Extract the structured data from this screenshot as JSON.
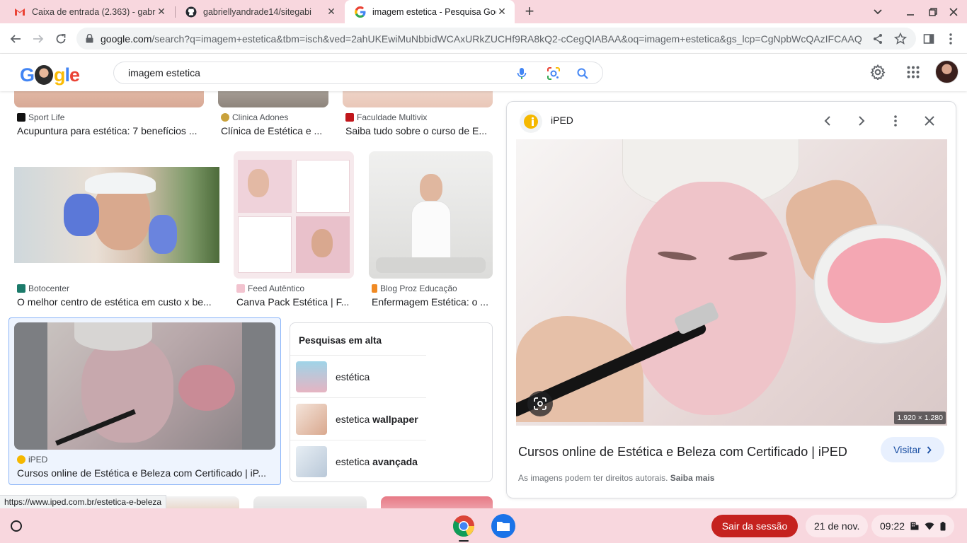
{
  "browser": {
    "tabs": [
      {
        "title": "Caixa de entrada (2.363) - gabri",
        "favicon": "gmail-icon",
        "active": false
      },
      {
        "title": "gabriellyandrade14/sitegabi",
        "favicon": "github-icon",
        "active": false
      },
      {
        "title": "imagem estetica - Pesquisa Goo",
        "favicon": "google-icon",
        "active": true
      }
    ],
    "url_host": "google.com",
    "url_rest": "/search?q=imagem+estetica&tbm=isch&ved=2ahUKEwiMuNbbidWCAxURkZUCHf9RA8kQ2-cCegQIABAA&oq=imagem+estetica&gs_lcp=CgNpbWcQAzIFCAAQg...",
    "colors": {
      "tabstrip": "#f8d7de",
      "shelf": "#f8d7de"
    }
  },
  "google": {
    "logo_text": "Google",
    "query": "imagem estetica"
  },
  "results": [
    {
      "source": "Sport Life",
      "title": "Acupuntura para estética: 7 benefícios ...",
      "fav_color": "#111111"
    },
    {
      "source": "Clinica Adones",
      "title": "Clínica de Estética e ...",
      "fav_color": "#c9a23c"
    },
    {
      "source": "Faculdade Multivix",
      "title": "Saiba tudo sobre o curso de E...",
      "fav_color": "#c0161b"
    },
    {
      "source": "Botocenter",
      "title": "O melhor centro de estética em custo x be...",
      "fav_color": "#1b7a6a"
    },
    {
      "source": "Feed Autêntico",
      "title": "Canva Pack Estética | F...",
      "fav_color": "#f2c3cf"
    },
    {
      "source": "Blog Proz Educação",
      "title": "Enfermagem Estética: o ...",
      "fav_color": "#f08a24"
    },
    {
      "source": "iPED",
      "title": "Cursos online de Estética e Beleza com Certificado | iP...",
      "fav_color": "#f5b800"
    }
  ],
  "trending": {
    "heading": "Pesquisas em alta",
    "items": [
      {
        "prefix": "estética",
        "bold": ""
      },
      {
        "prefix": "estetica ",
        "bold": "wallpaper"
      },
      {
        "prefix": "estetica ",
        "bold": "avançada"
      }
    ]
  },
  "preview": {
    "source": "iPED",
    "dimensions": "1.920 × 1.280",
    "title": "Cursos online de Estética e Beleza com Certificado | iPED",
    "visit_label": "Visitar",
    "rights_text": "As imagens podem ter direitos autorais.",
    "rights_link": "Saiba mais"
  },
  "status_url": "https://www.iped.com.br/estetica-e-beleza",
  "shelf": {
    "logout_label": "Sair da sessão",
    "date": "21 de nov.",
    "time": "09:22"
  }
}
